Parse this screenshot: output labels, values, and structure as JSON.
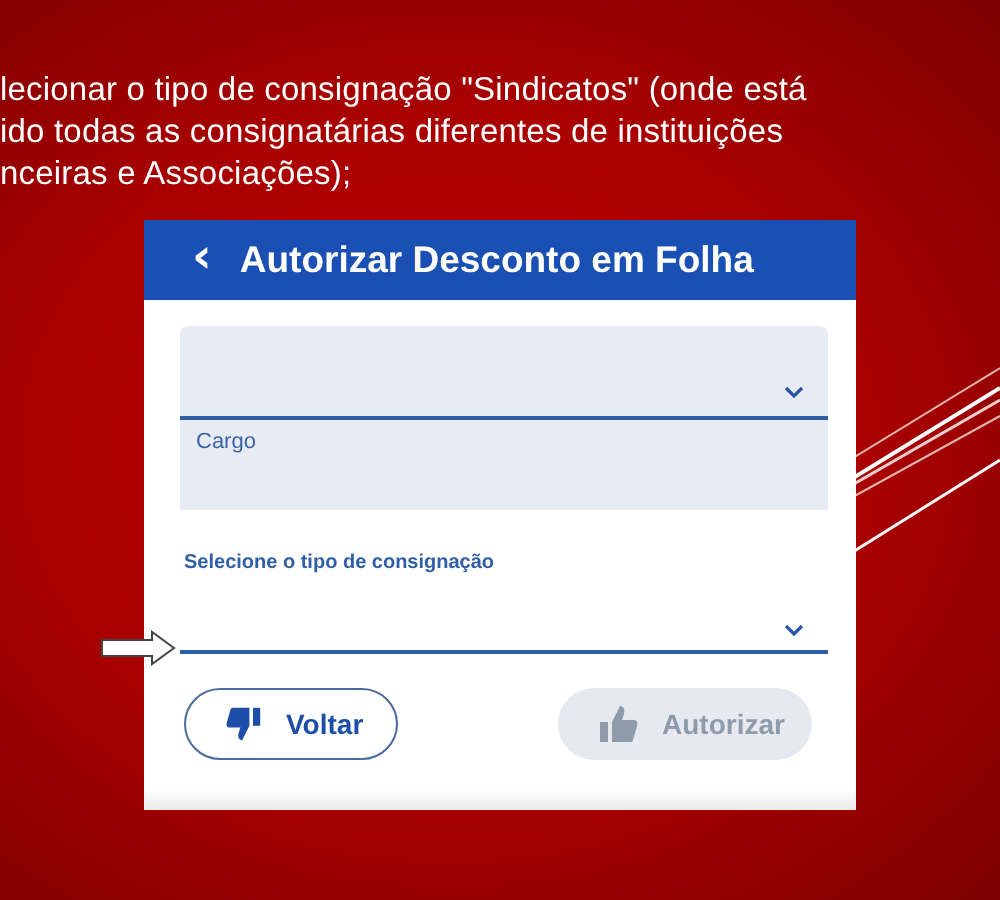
{
  "caption_lines": [
    "lecionar o tipo de consignação \"Sindicatos\" (onde está",
    "ido todas as consignatárias diferentes de instituições",
    "nceiras e Associações);"
  ],
  "app": {
    "back": "‹",
    "title": "Autorizar Desconto em Folha",
    "fields": [
      {
        "kind": "filled",
        "label": "Cargo"
      },
      {
        "kind": "underlined",
        "label": "Selecione o tipo de consignação",
        "pointed": true
      }
    ],
    "buttons": [
      {
        "kind": "back",
        "label": "Voltar",
        "disabled": false
      },
      {
        "kind": "confirm",
        "label": "Autorizar",
        "disabled": true
      }
    ]
  }
}
